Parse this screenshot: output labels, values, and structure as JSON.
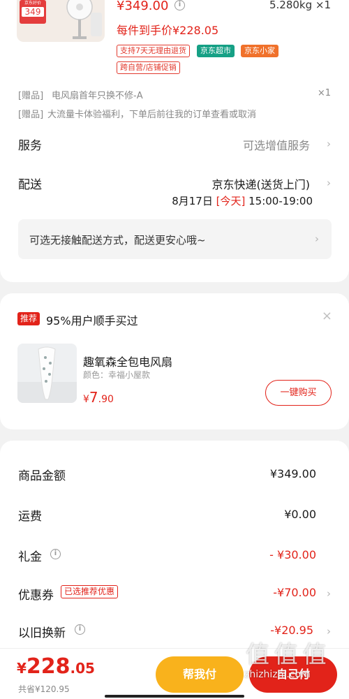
{
  "product": {
    "thumb_badge_top": "京东好价",
    "thumb_badge_price": "349",
    "price": "¥349.00",
    "weight_qty": "5.280kg ×1",
    "final_price": "每件到手价¥228.05",
    "tags": [
      "支持7天无理由退货",
      "京东超市",
      "京东小家",
      "跨自营/店铺促销"
    ],
    "gift1_prefix": "[赠品]",
    "gift1_text": "电风扇首年只换不修-A",
    "gift1_qty": "×1",
    "gift2_prefix": "[赠品]",
    "gift2_text": "大流量卡体验福利，下单后前往我的订单查看或取消"
  },
  "service": {
    "label": "服务",
    "value": "可选增值服务"
  },
  "delivery": {
    "label": "配送",
    "method": "京东快递(送货上门)",
    "date": "8月17日",
    "today": "[今天]",
    "time": "15:00-19:00",
    "contactless": "可选无接触配送方式，配送更安心哦~"
  },
  "recommend": {
    "badge": "推荐",
    "title": "95%用户顺手买过",
    "item_name": "趣氧森全包电风扇",
    "item_color": "颜色：幸福小屋款",
    "item_price_symbol": "¥",
    "item_price_int": "7",
    "item_price_dec": ".90",
    "buy_button": "一键购买"
  },
  "summary": {
    "goods_label": "商品金额",
    "goods_value": "¥349.00",
    "shipping_label": "运费",
    "shipping_value": "¥0.00",
    "gift_label": "礼金",
    "gift_value": "- ¥30.00",
    "coupon_label": "优惠券",
    "coupon_tag": "已选推荐优惠",
    "coupon_value": "-¥70.00",
    "tradein_label": "以旧换新",
    "tradein_value": "-¥20.95"
  },
  "footer": {
    "price_symbol": "¥",
    "price_int": "228",
    "price_dec": ".05",
    "saved": "共省¥120.95",
    "help_pay": "帮我付",
    "self_pay": "自己付"
  },
  "watermark": {
    "text": "值 值 值",
    "url": "zhizhizhi.com"
  },
  "colors": {
    "accent": "#e2231a",
    "help_pay": "#f9b21c",
    "green_tag": "#16a085",
    "orange_tag": "#f0712b"
  }
}
